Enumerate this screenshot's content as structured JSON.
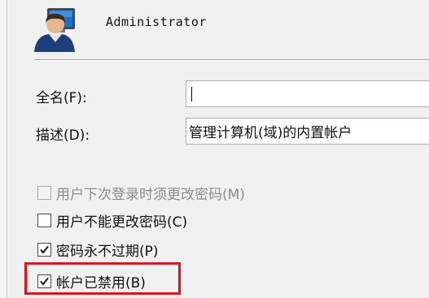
{
  "header": {
    "account_name": "Administrator",
    "icon": "user-account-icon"
  },
  "fields": {
    "fullname_label": "全名(F):",
    "fullname_value": "",
    "description_label": "描述(D):",
    "description_value": "管理计算机(域)的内置帐户"
  },
  "options": [
    {
      "label": "用户下次登录时须更改密码(M)",
      "checked": false,
      "enabled": false
    },
    {
      "label": "用户不能更改密码(C)",
      "checked": false,
      "enabled": true
    },
    {
      "label": "密码永不过期(P)",
      "checked": true,
      "enabled": true
    },
    {
      "label": "帐户已禁用(B)",
      "checked": true,
      "enabled": true
    }
  ],
  "colors": {
    "highlight_border": "#e0101a",
    "window_background": "#f0f0f0"
  }
}
